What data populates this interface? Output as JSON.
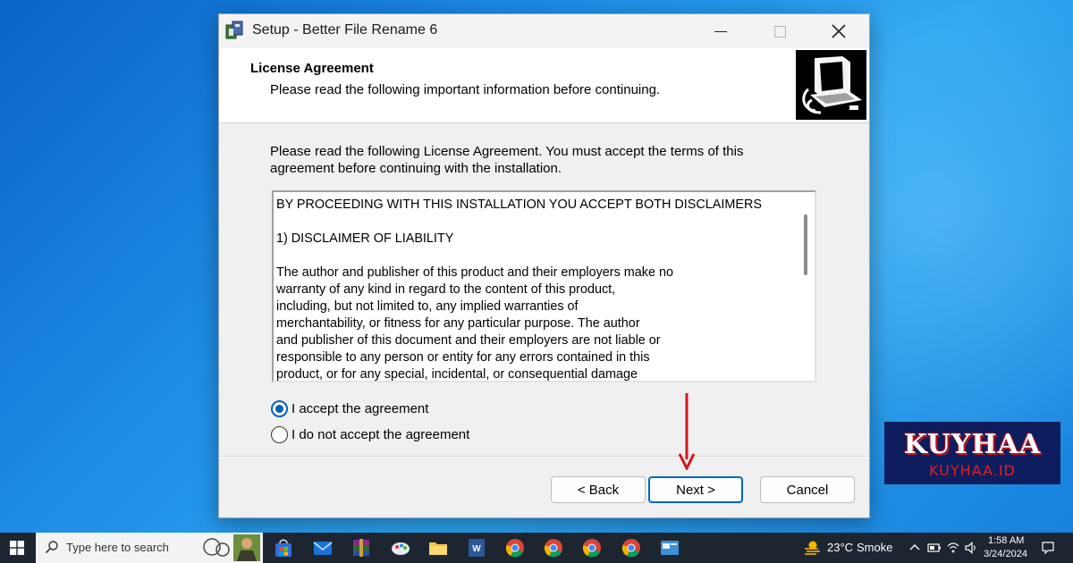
{
  "window": {
    "title": "Setup - Better File Rename 6",
    "header_title": "License Agreement",
    "header_subtitle": "Please read the following important information before continuing.",
    "intro_text": "Please read the following License Agreement. You must accept the terms of this agreement before continuing with the installation.",
    "license_lines": [
      "BY PROCEEDING WITH THIS INSTALLATION YOU ACCEPT BOTH DISCLAIMERS",
      "",
      "1) DISCLAIMER OF LIABILITY",
      "",
      "The author and publisher of this product and their employers make no",
      "warranty of any kind in regard to the content of this product,",
      "including, but not limited to, any implied warranties of",
      "merchantability, or fitness for any particular purpose. The author",
      "and publisher of this document and their employers are not liable or",
      "responsible to any person or entity for any errors contained in this",
      "product, or for any special, incidental, or consequential damage"
    ],
    "license_text": "BY PROCEEDING WITH THIS INSTALLATION YOU ACCEPT BOTH DISCLAIMERS\n\n1) DISCLAIMER OF LIABILITY\n\nThe author and publisher of this product and their employers make no\nwarranty of any kind in regard to the content of this product,\nincluding, but not limited to, any implied warranties of\nmerchantability, or fitness for any particular purpose. The author\nand publisher of this document and their employers are not liable or\nresponsible to any person or entity for any errors contained in this\nproduct, or for any special, incidental, or consequential damage",
    "radio_accept": "I accept the agreement",
    "radio_decline": "I do not accept the agreement",
    "selected_option": "accept",
    "buttons": {
      "back": "< Back",
      "next": "Next >",
      "cancel": "Cancel"
    }
  },
  "watermark": {
    "brand": "KUYHAA",
    "site": "KUYHAA.ID"
  },
  "taskbar": {
    "search_placeholder": "Type here to search",
    "apps": [
      "store-icon",
      "mail-icon",
      "winrar-icon",
      "paint-icon",
      "file-explorer-icon",
      "word-icon",
      "chrome-icon",
      "chrome-icon",
      "chrome-icon",
      "chrome-icon",
      "setup-icon"
    ],
    "weather_temp": "23°C",
    "weather_desc": "Smoke",
    "clock_time": "1:58 AM",
    "clock_date": "3/24/2024"
  },
  "colors": {
    "accent": "#0067c0",
    "arrow": "#d0191f",
    "desktop": "#1f8ee6",
    "watermark_bg": "#0e1d5e"
  }
}
